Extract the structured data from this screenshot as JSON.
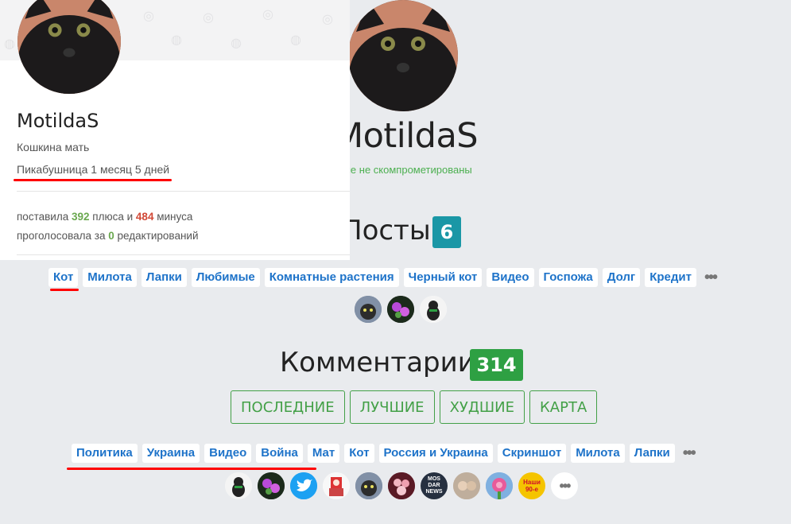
{
  "profile": {
    "name": "MotildaS",
    "bio": "Кошкина мать",
    "age": "Пикабушница 1 месяц 5 дней",
    "status_cut": "анные не скомпрометированы",
    "stats": {
      "given_prefix": "поставила",
      "pluses": "392",
      "pluses_label": "плюса и",
      "minuses": "484",
      "minuses_label": "минуса",
      "voted_prefix": "проголосовала за",
      "edits": "0",
      "edits_label": "редактирований"
    }
  },
  "posts": {
    "title_cut": "Посты",
    "count": "6",
    "tags": [
      "Кот",
      "Милота",
      "Лапки",
      "Любимые",
      "Комнатные растения",
      "Черный кот",
      "Видео",
      "Госпожа",
      "Долг",
      "Кредит"
    ],
    "more": "•••"
  },
  "comments": {
    "title": "Комментарии",
    "count": "314",
    "filters": [
      "ПОСЛЕДНИЕ",
      "ЛУЧШИЕ",
      "ХУДШИЕ",
      "КАРТА"
    ],
    "tags": [
      "Политика",
      "Украина",
      "Видео",
      "Война",
      "Мат",
      "Кот",
      "Россия и Украина",
      "Скриншот",
      "Милота",
      "Лапки"
    ],
    "more": "•••",
    "community_labels": {
      "mosdar": "MOS DAR NEWS",
      "nashi": "Наши 90-е"
    },
    "icons_more": "•••"
  },
  "colors": {
    "posts_badge": "#1a97a6",
    "comments_badge": "#2ea043",
    "accent_red": "#ff0000",
    "link_blue": "#1e73c9",
    "filter_green": "#43a047"
  }
}
